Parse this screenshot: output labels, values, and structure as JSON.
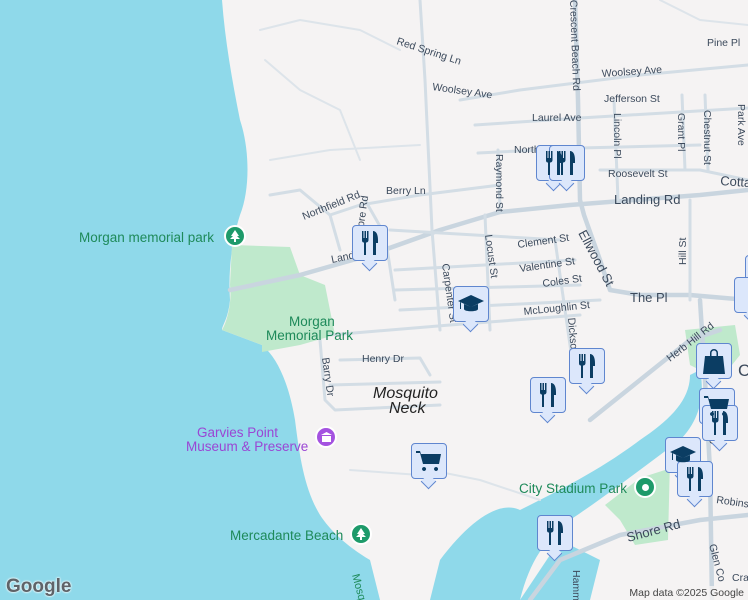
{
  "map": {
    "streets": {
      "red_spring": "Red Spring Ln",
      "woolsey_w": "Woolsey Ave",
      "woolsey_e": "Woolsey Ave",
      "crescent_beach": "Crescent Beach Rd",
      "pine": "Pine Pl",
      "jefferson": "Jefferson St",
      "laurel": "Laurel Ave",
      "lincoln": "Lincoln Pl",
      "grant": "Grant Pl",
      "chestnut": "Chestnut St",
      "park_ave": "Park Ave",
      "north": "North St",
      "raymond": "Raymond St",
      "roosevelt": "Roosevelt St",
      "cottage": "Cotta",
      "berry": "Berry Ln",
      "northfield": "Northfield Rd",
      "shore_rd_n": "Shore Rd",
      "landing_e": "Landing Rd",
      "landing_w": "Landing Rd",
      "clement": "Clement St",
      "valentine": "Valentine St",
      "coles": "Coles St",
      "mcloughlin": "McLoughlin St",
      "locust": "Locust St",
      "carpenter": "Carpenter St",
      "ellwood": "Ellwood St",
      "hill": "Hill St",
      "the_pl": "The Pl",
      "herb_hill": "Herb Hill Rd",
      "dickson": "Dickson",
      "henry": "Henry Dr",
      "barry": "Barry Dr",
      "shore_rd_s": "Shore Rd",
      "glen_cove": "Glen Co",
      "glen_n": "Glen",
      "robinson": "Robins",
      "cra": "Cra",
      "hamm": "Hamm",
      "c_label": "C"
    },
    "places": {
      "morgan_memorial_park_n": "Morgan memorial park",
      "morgan_memorial_park_1": "Morgan",
      "morgan_memorial_park_2": "Memorial Park",
      "garvies_1": "Garvies Point",
      "garvies_2": "Museum & Preserve",
      "mercadante": "Mercadante Beach",
      "city_stadium": "City Stadium Park",
      "mosquito_1": "Mosquito",
      "mosquito_2": "Neck",
      "water_label": "Mosq"
    },
    "colors": {
      "water": "#8fd9ea",
      "park": "#bfe9cc",
      "marker_icon": "#0b3d63",
      "park_pin": "#1e9a6a",
      "museum_pin": "#a452e0"
    }
  },
  "footer": {
    "logo": "Google",
    "attribution": "Map data ©2025 Google"
  }
}
